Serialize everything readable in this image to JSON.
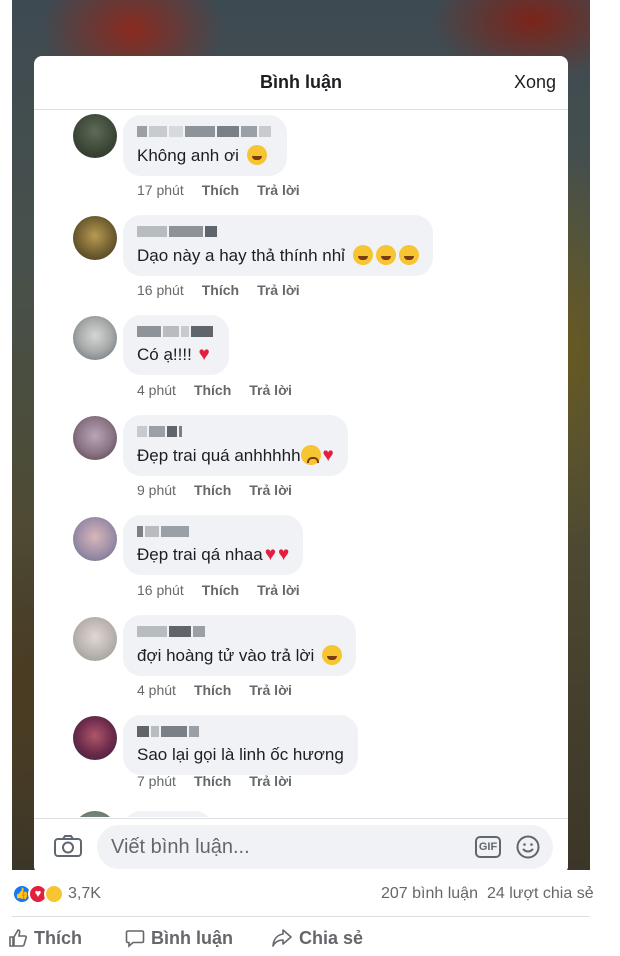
{
  "modal": {
    "title": "Bình luận",
    "done_label": "Xong"
  },
  "comment_actions": {
    "like": "Thích",
    "reply": "Trả lời"
  },
  "comments": [
    {
      "text": "Không anh ơi",
      "time": "17 phút",
      "emoji": "laughing-emoji"
    },
    {
      "text": "Dạo này a hay thả thính nhỉ",
      "time": "16 phút",
      "emoji": "rofl-emoji x3"
    },
    {
      "text": "Có ạ!!!!",
      "time": "4 phút",
      "emoji": "heart"
    },
    {
      "text": "Đẹp trai quá anhhhhh",
      "time": "9 phút",
      "emoji": "crying-emoji, heart"
    },
    {
      "text": "Đẹp trai qá nhaa",
      "time": "16 phút",
      "emoji": "heart x2"
    },
    {
      "text": "đợi hoàng tử  vào trả lời",
      "time": "4 phút",
      "emoji": "laughing-emoji"
    },
    {
      "text": "Sao lại gọi là linh ốc hương",
      "time": "7 phút",
      "emoji": ""
    }
  ],
  "composer": {
    "placeholder": "Viết bình luận...",
    "camera_icon": "camera-icon",
    "gif_label": "GIF",
    "emoji_icon": "smile-icon"
  },
  "post_stats": {
    "reaction_count": "3,7K",
    "comment_count": "207 bình luận",
    "share_count": "24 lượt chia sẻ"
  },
  "post_actions": {
    "like": "Thích",
    "comment": "Bình luận",
    "share": "Chia sẻ"
  },
  "colors": {
    "bubble": "#f0f2f5",
    "meta_text": "#65676b",
    "heart": "#e41e3f",
    "like_blue": "#1877f2"
  }
}
